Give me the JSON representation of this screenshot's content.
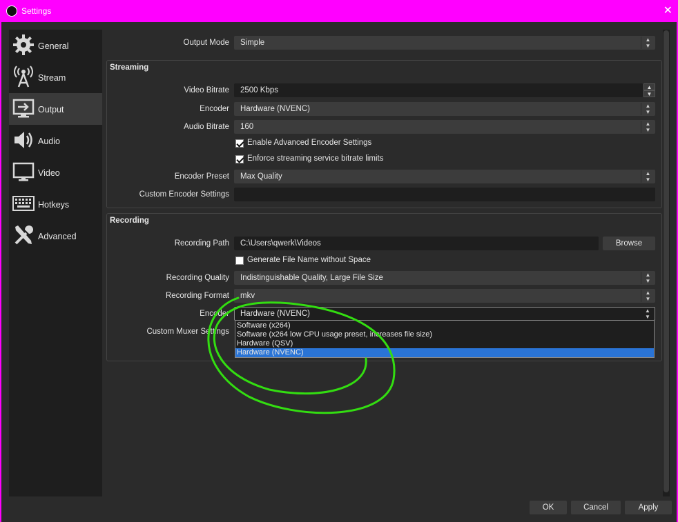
{
  "window": {
    "title": "Settings",
    "close_glyph": "✕"
  },
  "sidebar": {
    "items": [
      {
        "label": "General",
        "icon": "gear-icon"
      },
      {
        "label": "Stream",
        "icon": "antenna-icon"
      },
      {
        "label": "Output",
        "icon": "output-icon"
      },
      {
        "label": "Audio",
        "icon": "speaker-icon"
      },
      {
        "label": "Video",
        "icon": "monitor-icon"
      },
      {
        "label": "Hotkeys",
        "icon": "keyboard-icon"
      },
      {
        "label": "Advanced",
        "icon": "tools-icon"
      }
    ],
    "active": "Output"
  },
  "output_mode": {
    "label": "Output Mode",
    "value": "Simple"
  },
  "streaming": {
    "title": "Streaming",
    "video_bitrate": {
      "label": "Video Bitrate",
      "value": "2500 Kbps"
    },
    "encoder": {
      "label": "Encoder",
      "value": "Hardware (NVENC)"
    },
    "audio_bitrate": {
      "label": "Audio Bitrate",
      "value": "160"
    },
    "enable_advanced": {
      "label": "Enable Advanced Encoder Settings",
      "checked": true
    },
    "enforce_limits": {
      "label": "Enforce streaming service bitrate limits",
      "checked": true
    },
    "encoder_preset": {
      "label": "Encoder Preset",
      "value": "Max Quality"
    },
    "custom_encoder": {
      "label": "Custom Encoder Settings",
      "value": ""
    }
  },
  "recording": {
    "title": "Recording",
    "path": {
      "label": "Recording Path",
      "value": "C:\\Users\\qwerk\\Videos"
    },
    "browse_label": "Browse",
    "generate_name": {
      "label": "Generate File Name without Space",
      "checked": false
    },
    "quality": {
      "label": "Recording Quality",
      "value": "Indistinguishable Quality, Large File Size"
    },
    "format": {
      "label": "Recording Format",
      "value": "mkv"
    },
    "encoder": {
      "label": "Encoder",
      "value": "Hardware (NVENC)"
    },
    "custom_muxer": {
      "label": "Custom Muxer Settings"
    },
    "encoder_options": [
      "Software (x264)",
      "Software (x264 low CPU usage preset, increases file size)",
      "Hardware (QSV)",
      "Hardware (NVENC)"
    ],
    "selected_option_index": 3
  },
  "footer": {
    "ok_label": "OK",
    "cancel_label": "Cancel",
    "apply_label": "Apply"
  },
  "colors": {
    "accent": "#2a74d6",
    "annotation": "#33dd11",
    "titlebar": "#ff00ff"
  }
}
